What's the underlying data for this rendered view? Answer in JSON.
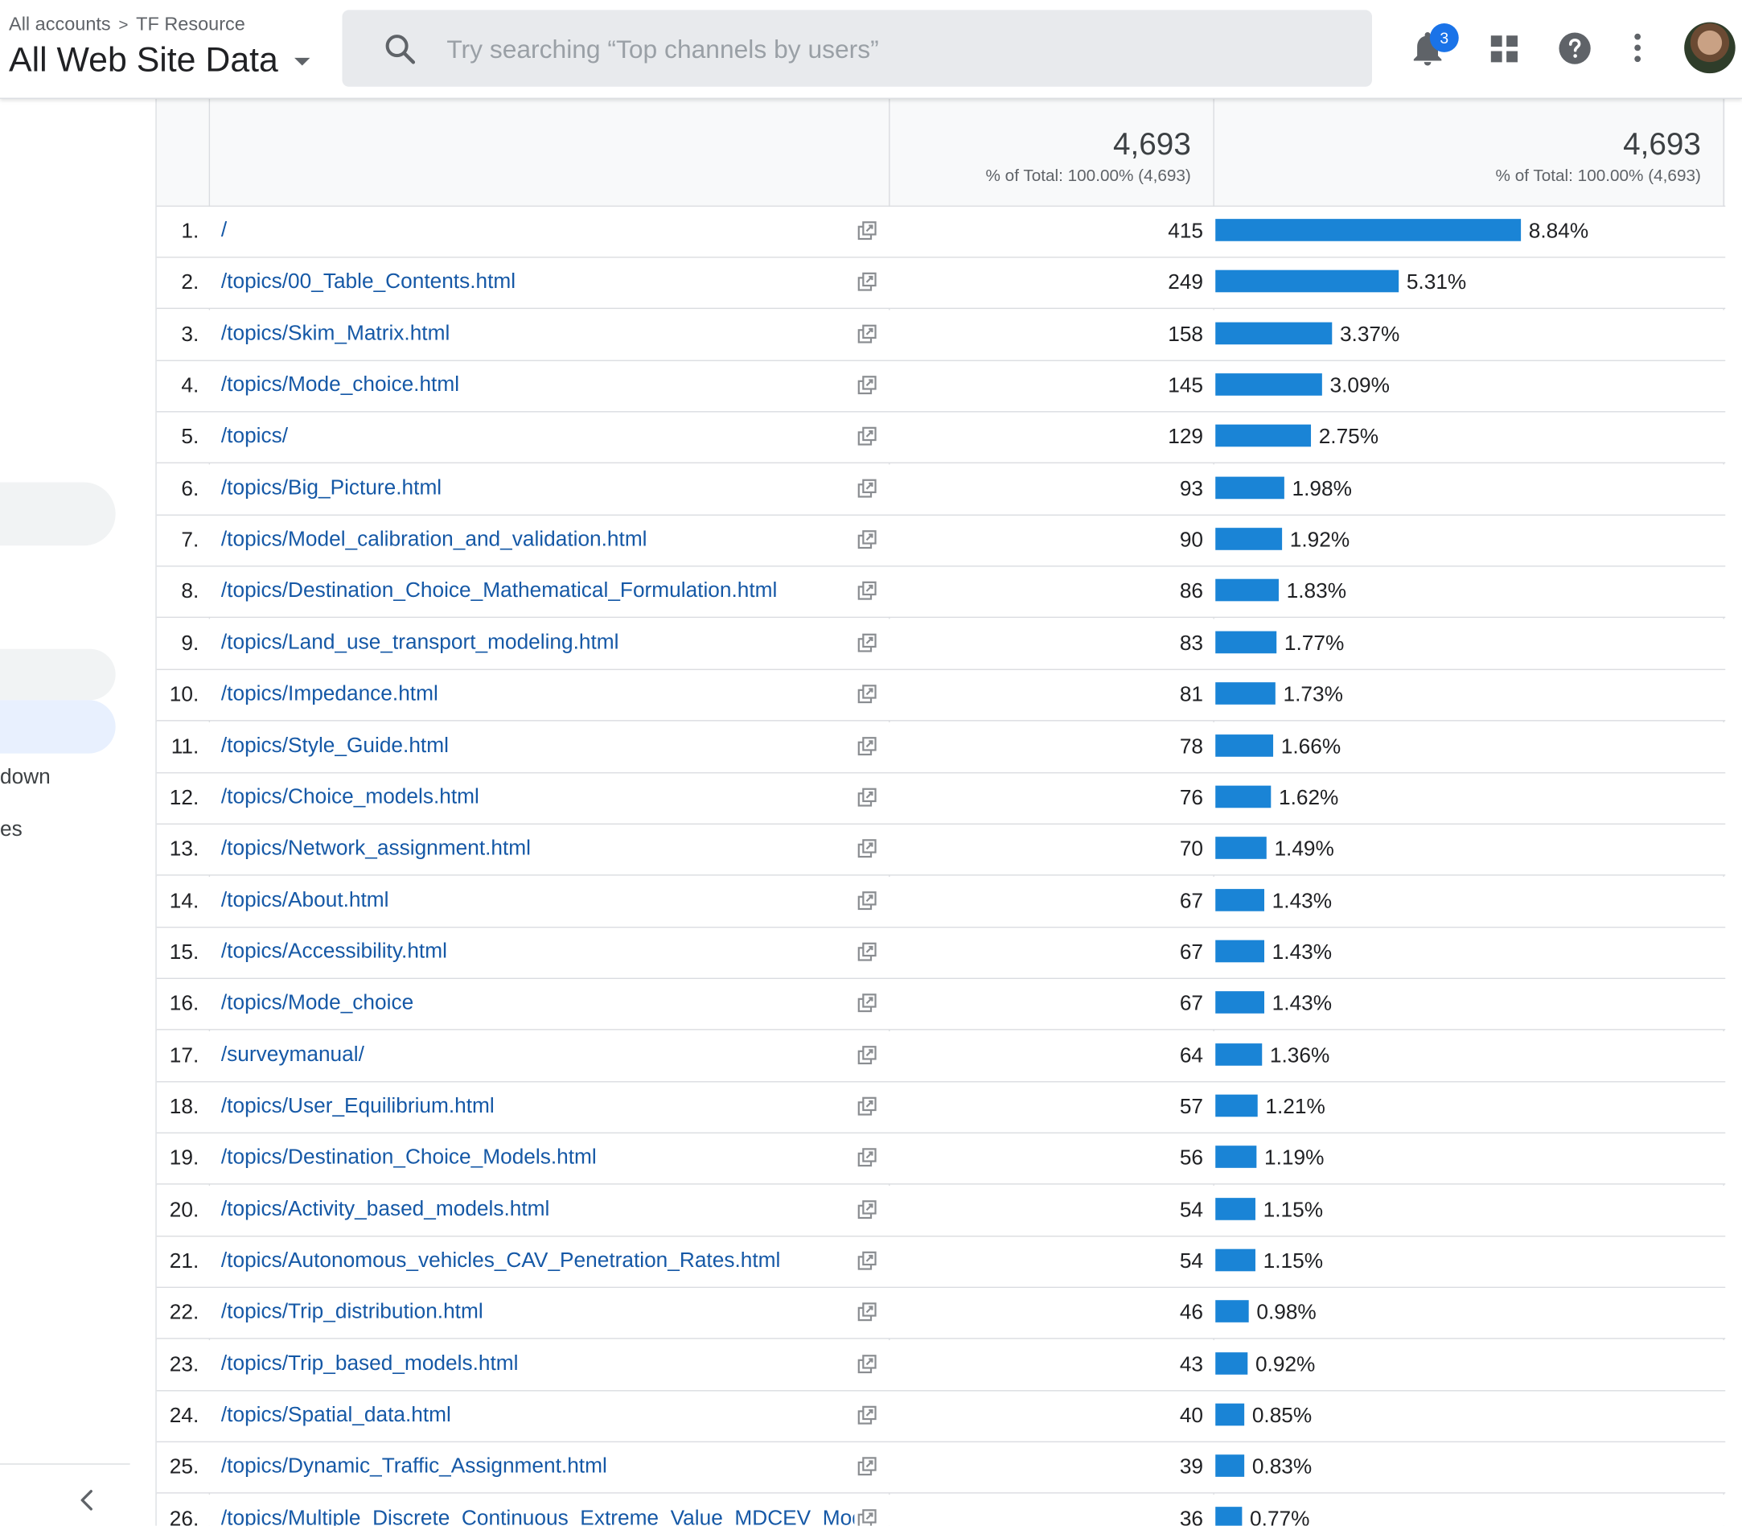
{
  "header": {
    "breadcrumb": [
      "All accounts",
      "TF Resource"
    ],
    "breadcrumb_separator": ">",
    "view_title": "All Web Site Data",
    "search_placeholder": "Try searching “Top channels by users”",
    "notification_count": "3"
  },
  "nav": {
    "partial_items": [
      "down",
      "es"
    ]
  },
  "table": {
    "totals": [
      {
        "value": "4,693",
        "caption": "% of Total: 100.00% (4,693)"
      },
      {
        "value": "4,693",
        "caption": "% of Total: 100.00% (4,693)"
      }
    ],
    "bar_color": "#1a84d6",
    "link_color": "#1558a6",
    "rows": [
      {
        "rank": "1.",
        "page": "/",
        "value": "415",
        "percent": "8.84%",
        "share": 0.0884
      },
      {
        "rank": "2.",
        "page": "/topics/00_Table_Contents.html",
        "value": "249",
        "percent": "5.31%",
        "share": 0.0531
      },
      {
        "rank": "3.",
        "page": "/topics/Skim_Matrix.html",
        "value": "158",
        "percent": "3.37%",
        "share": 0.0337
      },
      {
        "rank": "4.",
        "page": "/topics/Mode_choice.html",
        "value": "145",
        "percent": "3.09%",
        "share": 0.0309
      },
      {
        "rank": "5.",
        "page": "/topics/",
        "value": "129",
        "percent": "2.75%",
        "share": 0.0275
      },
      {
        "rank": "6.",
        "page": "/topics/Big_Picture.html",
        "value": "93",
        "percent": "1.98%",
        "share": 0.0198
      },
      {
        "rank": "7.",
        "page": "/topics/Model_calibration_and_validation.html",
        "value": "90",
        "percent": "1.92%",
        "share": 0.0192
      },
      {
        "rank": "8.",
        "page": "/topics/Destination_Choice_Mathematical_Formulation.html",
        "value": "86",
        "percent": "1.83%",
        "share": 0.0183
      },
      {
        "rank": "9.",
        "page": "/topics/Land_use_transport_modeling.html",
        "value": "83",
        "percent": "1.77%",
        "share": 0.0177
      },
      {
        "rank": "10.",
        "page": "/topics/Impedance.html",
        "value": "81",
        "percent": "1.73%",
        "share": 0.0173
      },
      {
        "rank": "11.",
        "page": "/topics/Style_Guide.html",
        "value": "78",
        "percent": "1.66%",
        "share": 0.0166
      },
      {
        "rank": "12.",
        "page": "/topics/Choice_models.html",
        "value": "76",
        "percent": "1.62%",
        "share": 0.0162
      },
      {
        "rank": "13.",
        "page": "/topics/Network_assignment.html",
        "value": "70",
        "percent": "1.49%",
        "share": 0.0149
      },
      {
        "rank": "14.",
        "page": "/topics/About.html",
        "value": "67",
        "percent": "1.43%",
        "share": 0.0143
      },
      {
        "rank": "15.",
        "page": "/topics/Accessibility.html",
        "value": "67",
        "percent": "1.43%",
        "share": 0.0143
      },
      {
        "rank": "16.",
        "page": "/topics/Mode_choice",
        "value": "67",
        "percent": "1.43%",
        "share": 0.0143
      },
      {
        "rank": "17.",
        "page": "/surveymanual/",
        "value": "64",
        "percent": "1.36%",
        "share": 0.0136
      },
      {
        "rank": "18.",
        "page": "/topics/User_Equilibrium.html",
        "value": "57",
        "percent": "1.21%",
        "share": 0.0121
      },
      {
        "rank": "19.",
        "page": "/topics/Destination_Choice_Models.html",
        "value": "56",
        "percent": "1.19%",
        "share": 0.0119
      },
      {
        "rank": "20.",
        "page": "/topics/Activity_based_models.html",
        "value": "54",
        "percent": "1.15%",
        "share": 0.0115
      },
      {
        "rank": "21.",
        "page": "/topics/Autonomous_vehicles_CAV_Penetration_Rates.html",
        "value": "54",
        "percent": "1.15%",
        "share": 0.0115
      },
      {
        "rank": "22.",
        "page": "/topics/Trip_distribution.html",
        "value": "46",
        "percent": "0.98%",
        "share": 0.0098
      },
      {
        "rank": "23.",
        "page": "/topics/Trip_based_models.html",
        "value": "43",
        "percent": "0.92%",
        "share": 0.0092
      },
      {
        "rank": "24.",
        "page": "/topics/Spatial_data.html",
        "value": "40",
        "percent": "0.85%",
        "share": 0.0085
      },
      {
        "rank": "25.",
        "page": "/topics/Dynamic_Traffic_Assignment.html",
        "value": "39",
        "percent": "0.83%",
        "share": 0.0083
      },
      {
        "rank": "26.",
        "page": "/topics/Multiple_Discrete_Continuous_Extreme_Value_MDCEV_Mod",
        "value": "36",
        "percent": "0.77%",
        "share": 0.0077
      }
    ]
  }
}
